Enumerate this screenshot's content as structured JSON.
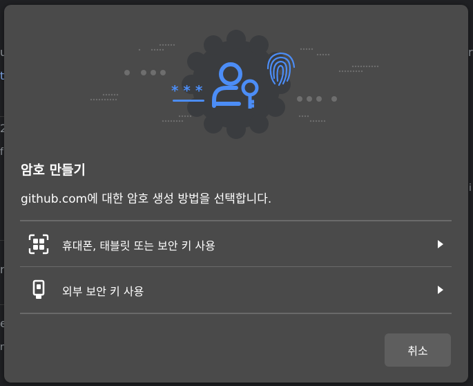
{
  "dialog": {
    "title": "암호 만들기",
    "subtitle": "github.com에 대한 암호 생성 방법을 선택합니다.",
    "options": [
      {
        "label": "휴대폰, 태블릿 또는 보안 키 사용",
        "icon": "qr-code-icon"
      },
      {
        "label": "외부 보안 키 사용",
        "icon": "usb-key-icon"
      }
    ],
    "cancel_label": "취소"
  },
  "illustration": {
    "icons": [
      "password-dots-icon",
      "passkey-person-icon",
      "fingerprint-icon"
    ],
    "accent_color": "#4c8df6",
    "badge_color": "#3a3c3f"
  },
  "background": {
    "edge_glyphs_left": [
      "u",
      "t",
      "2",
      "f",
      "r",
      "e",
      "n"
    ],
    "edge_glyphs_right": [
      "r",
      "i"
    ]
  },
  "colors": {
    "dialog_bg": "#4a4a4a",
    "page_bg": "#202124",
    "text": "#ffffff",
    "button_bg": "#5e5e5e"
  }
}
